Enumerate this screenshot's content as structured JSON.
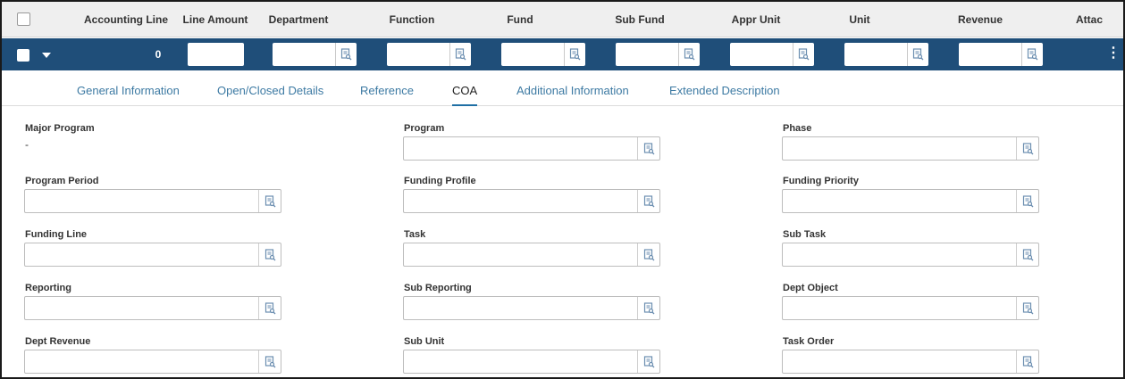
{
  "grid": {
    "headers": [
      "Accounting Line",
      "Line Amount",
      "Department",
      "Function",
      "Fund",
      "Sub Fund",
      "Appr Unit",
      "Unit",
      "Revenue",
      "Attac"
    ],
    "row": {
      "accounting_line": "0"
    }
  },
  "tabs": [
    "General Information",
    "Open/Closed Details",
    "Reference",
    "COA",
    "Additional Information",
    "Extended Description"
  ],
  "active_tab": "COA",
  "fields": {
    "major_program": {
      "label": "Major Program",
      "value": "-"
    },
    "program": {
      "label": "Program"
    },
    "phase": {
      "label": "Phase"
    },
    "program_period": {
      "label": "Program Period"
    },
    "funding_profile": {
      "label": "Funding Profile"
    },
    "funding_priority": {
      "label": "Funding Priority"
    },
    "funding_line": {
      "label": "Funding Line"
    },
    "task": {
      "label": "Task"
    },
    "sub_task": {
      "label": "Sub Task"
    },
    "reporting": {
      "label": "Reporting"
    },
    "sub_reporting": {
      "label": "Sub Reporting"
    },
    "dept_object": {
      "label": "Dept Object"
    },
    "dept_revenue": {
      "label": "Dept Revenue"
    },
    "sub_unit": {
      "label": "Sub Unit"
    },
    "task_order": {
      "label": "Task Order"
    }
  },
  "colors": {
    "row_bg": "#1f4e79",
    "header_bg": "#efefef",
    "tab_link": "#3d7aa3",
    "icon": "#6b8eb0"
  },
  "icons": [
    "lookup-icon",
    "chevron-down-icon",
    "more-vertical-icon"
  ]
}
